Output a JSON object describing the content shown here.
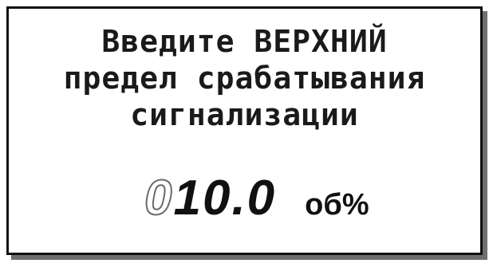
{
  "screen": {
    "prompt_lines": [
      "Введите ВЕРХНИЙ",
      "предел срабатывания",
      "сигнализации"
    ],
    "value": {
      "cursor_digit": "0",
      "fixed_digits": "10.0"
    },
    "unit": "об%"
  }
}
